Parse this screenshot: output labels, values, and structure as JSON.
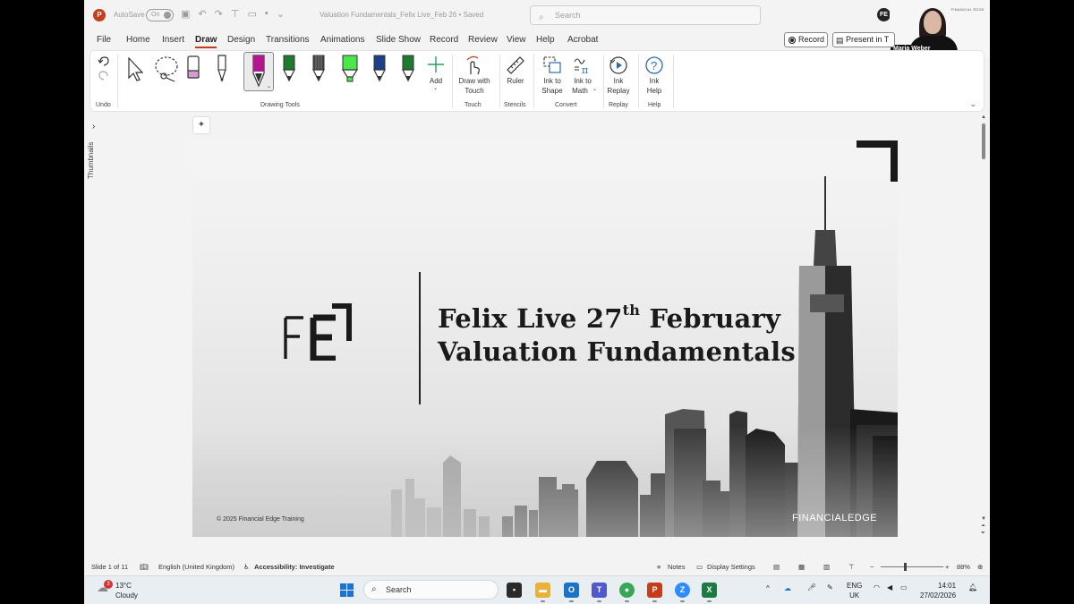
{
  "titlebar": {
    "autosave_label": "AutoSave",
    "autosave_state": "On",
    "doc_title": "Valuation Fundamentals_Felix Live_Feb 26 • Saved",
    "search_placeholder": "Search",
    "account_initials": "FE"
  },
  "webcam": {
    "brand": "FINANCIAL EDGE",
    "presenter_name": "Maria Weber"
  },
  "menu": {
    "tabs": [
      "File",
      "Home",
      "Insert",
      "Draw",
      "Design",
      "Transitions",
      "Animations",
      "Slide Show",
      "Record",
      "Review",
      "View",
      "Help",
      "Acrobat"
    ],
    "active_tab": "Draw",
    "record_label": "Record",
    "present_label": "Present in T"
  },
  "ribbon": {
    "groups": {
      "undo": "Undo",
      "drawing_tools": "Drawing Tools",
      "touch": "Touch",
      "stencils": "Stencils",
      "convert": "Convert",
      "replay": "Replay",
      "help": "Help"
    },
    "add_label": "Add",
    "draw_with_touch": [
      "Draw with",
      "Touch"
    ],
    "ruler_label": "Ruler",
    "ink_to_shape": [
      "Ink to",
      "Shape"
    ],
    "ink_to_math": [
      "Ink to",
      "Math"
    ],
    "ink_replay": [
      "Ink",
      "Replay"
    ],
    "ink_help": [
      "Ink",
      "Help"
    ],
    "pen_colors": [
      "#b3168f",
      "#1e7a2e",
      "#444444",
      "#4be84b",
      "#1c3f8a",
      "#1e7a2e"
    ]
  },
  "pane": {
    "thumbnails_label": "Thumbnails"
  },
  "slide": {
    "title_line1_pre": "Felix Live 27",
    "title_line1_sup": "th",
    "title_line1_post": " February",
    "title_line2": "Valuation Fundamentals",
    "copyright": "© 2025 Financial Edge Training",
    "brand_footer": "FINANCIALEDGE"
  },
  "statusbar": {
    "slide_info": "Slide 1 of 11",
    "language": "English (United Kingdom)",
    "accessibility": "Accessibility: Investigate",
    "notes": "Notes",
    "display_settings": "Display Settings",
    "zoom": "88%"
  },
  "taskbar": {
    "temperature": "13°C",
    "condition": "Cloudy",
    "weather_badge": "3",
    "search_label": "Search",
    "lang_line1": "ENG",
    "lang_line2": "UK",
    "time": "14:01",
    "date": "27/02/2026"
  }
}
